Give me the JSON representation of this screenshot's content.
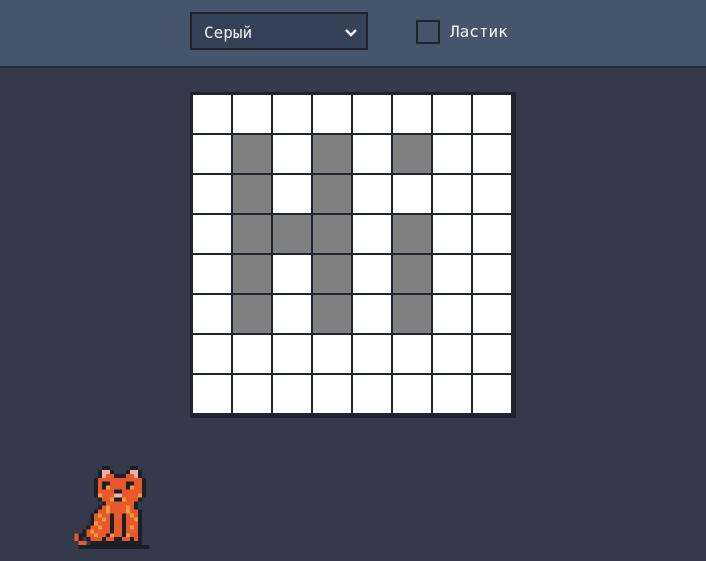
{
  "toolbar": {
    "color_select": {
      "value": "Серый"
    },
    "eraser": {
      "label": "Ластик",
      "checked": false
    }
  },
  "canvas": {
    "rows": 8,
    "cols": 8,
    "paint_color": "#808080",
    "empty_color": "#ffffff",
    "pixels": [
      [
        0,
        0,
        0,
        0,
        0,
        0,
        0,
        0
      ],
      [
        0,
        1,
        0,
        1,
        0,
        1,
        0,
        0
      ],
      [
        0,
        1,
        0,
        1,
        0,
        0,
        0,
        0
      ],
      [
        0,
        1,
        1,
        1,
        0,
        1,
        0,
        0
      ],
      [
        0,
        1,
        0,
        1,
        0,
        1,
        0,
        0
      ],
      [
        0,
        1,
        0,
        1,
        0,
        1,
        0,
        0
      ],
      [
        0,
        0,
        0,
        0,
        0,
        0,
        0,
        0
      ],
      [
        0,
        0,
        0,
        0,
        0,
        0,
        0,
        0
      ]
    ]
  },
  "mascot": {
    "icon": "pixel-cat-icon",
    "colors": [
      "#e8582a",
      "#f59a3c",
      "#1b1f27",
      "#f6b0a8"
    ]
  }
}
